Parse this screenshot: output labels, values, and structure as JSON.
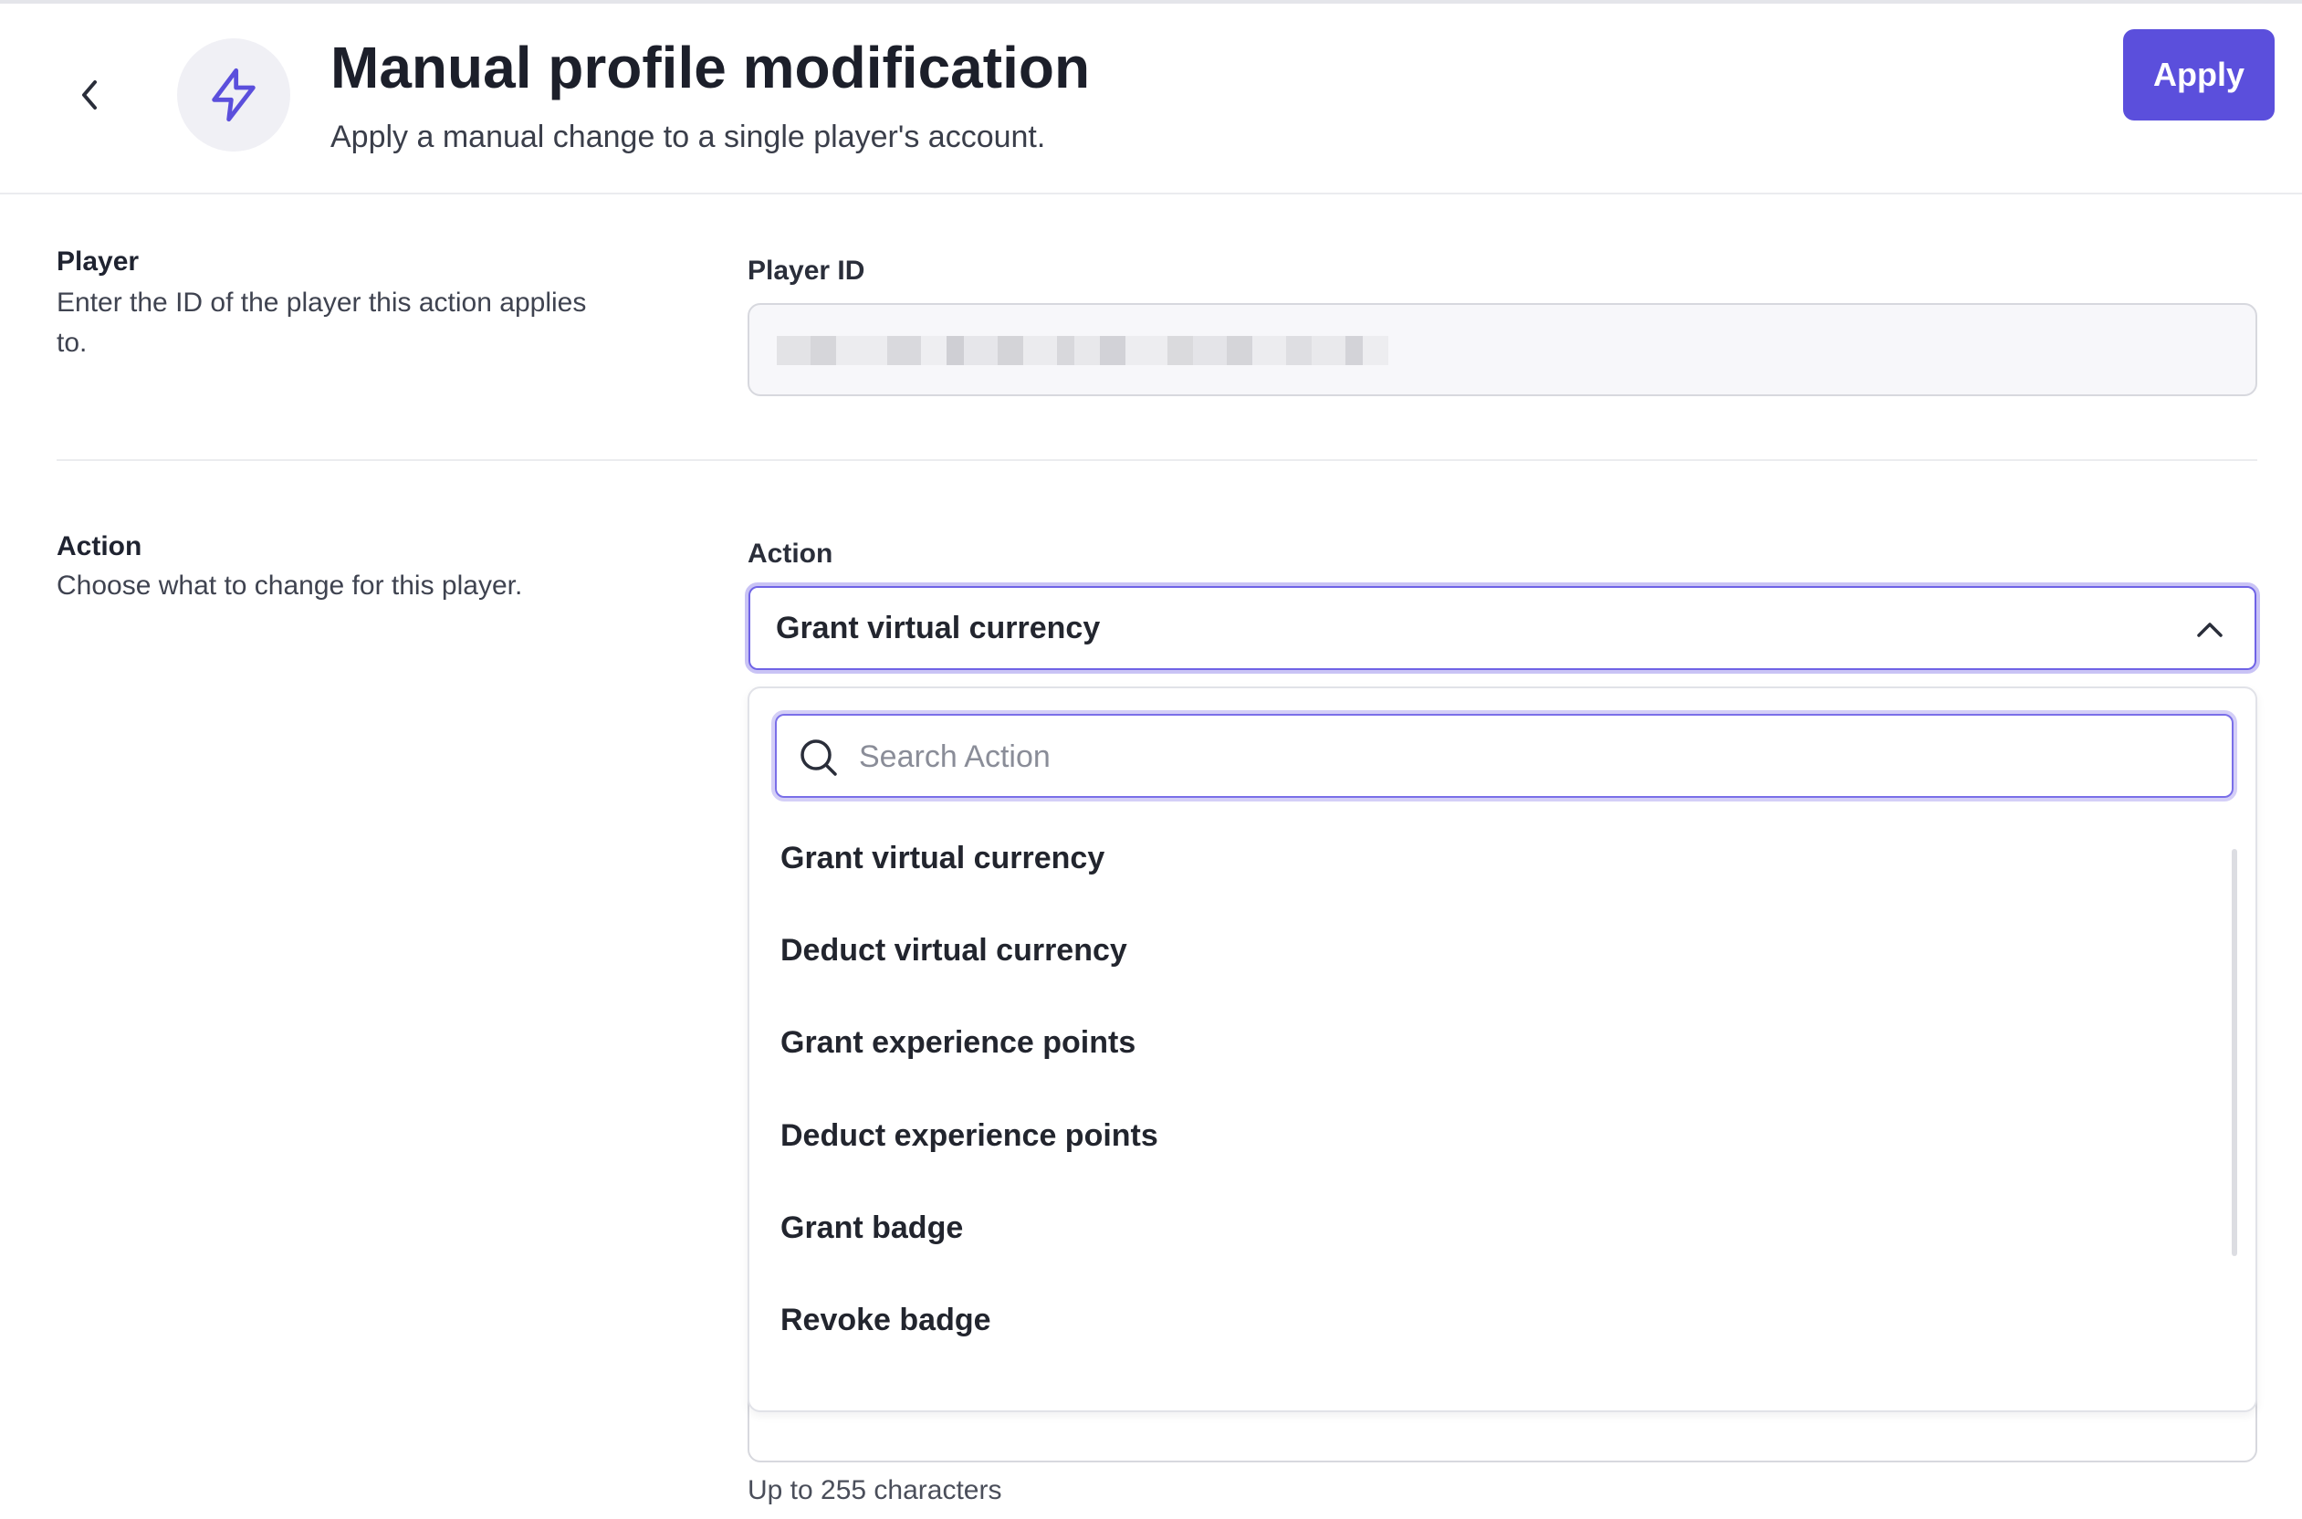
{
  "header": {
    "title": "Manual profile modification",
    "subtitle": "Apply a manual change to a single player's account.",
    "apply_label": "Apply",
    "icon": "lightning-bolt-icon",
    "back_icon": "chevron-left-icon"
  },
  "player_section": {
    "title": "Player",
    "description": "Enter the ID of the player this action applies to.",
    "field_label": "Player ID"
  },
  "action_section": {
    "title": "Action",
    "description": "Choose what to change for this player.",
    "field_label": "Action",
    "selected_value": "Grant virtual currency",
    "search_placeholder": "Search Action",
    "options": [
      "Grant virtual currency",
      "Deduct virtual currency",
      "Grant experience points",
      "Deduct experience points",
      "Grant badge",
      "Revoke badge"
    ]
  },
  "footer_hint": "Up to 255 characters",
  "colors": {
    "accent": "#5b4fdc",
    "focus_ring": "#c9c3f5",
    "divider": "#ebecef"
  }
}
